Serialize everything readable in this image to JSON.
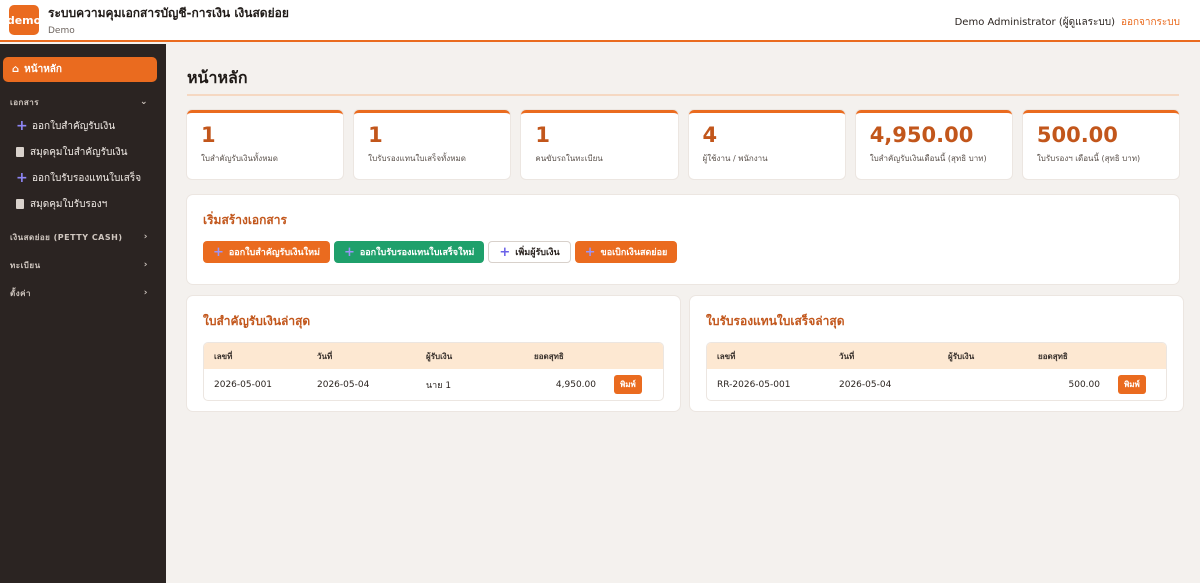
{
  "header": {
    "logo": "demo",
    "app_title": "ระบบความคุมเอกสารบัญชี-การเงิน เงินสดย่อย",
    "app_subtitle": "Demo",
    "user": "Demo Administrator (ผู้ดูแลระบบ)",
    "logout": "ออกจากระบบ"
  },
  "sidebar": {
    "home": "หน้าหลัก",
    "section_docs": "เอกสาร",
    "items": [
      {
        "label": "ออกใบสำคัญรับเงิน",
        "icon": "plus-icon"
      },
      {
        "label": "สมุดคุมใบสำคัญรับเงิน",
        "icon": "document-icon"
      },
      {
        "label": "ออกใบรับรองแทนใบเสร็จ",
        "icon": "plus-icon"
      },
      {
        "label": "สมุดคุมใบรับรองฯ",
        "icon": "document-icon"
      }
    ],
    "section_petty": "เงินสดย่อย (PETTY CASH)",
    "section_registry": "ทะเบียน",
    "section_settings": "ตั้งค่า"
  },
  "main": {
    "page_title": "หน้าหลัก",
    "stats": [
      {
        "value": "1",
        "label": "ใบสำคัญรับเงินทั้งหมด"
      },
      {
        "value": "1",
        "label": "ใบรับรองแทนใบเสร็จทั้งหมด"
      },
      {
        "value": "1",
        "label": "คนขับรถในทะเบียน"
      },
      {
        "value": "4",
        "label": "ผู้ใช้งาน / พนักงาน"
      },
      {
        "value": "4,950.00",
        "label": "ใบสำคัญรับเงินเดือนนี้ (สุทธิ บาท)"
      },
      {
        "value": "500.00",
        "label": "ใบรับรองฯ เดือนนี้ (สุทธิ บาท)"
      }
    ],
    "quick": {
      "title": "เริ่มสร้างเอกสาร",
      "buttons": [
        "ออกใบสำคัญรับเงินใหม่",
        "ออกใบรับรองแทนใบเสร็จใหม่",
        "เพิ่มผู้รับเงิน",
        "ขอเบิกเงินสดย่อย"
      ]
    },
    "receipts": {
      "title": "ใบสำคัญรับเงินล่าสุด",
      "headers": [
        "เลขที่",
        "วันที่",
        "ผู้รับเงิน",
        "ยอดสุทธิ"
      ],
      "rows": [
        {
          "no": "2026-05-001",
          "date": "2026-05-04",
          "payee": "นาย 1",
          "amount": "4,950.00",
          "action": "พิมพ์"
        }
      ]
    },
    "certs": {
      "title": "ใบรับรองแทนใบเสร็จล่าสุด",
      "headers": [
        "เลขที่",
        "วันที่",
        "ผู้รับเงิน",
        "ยอดสุทธิ"
      ],
      "rows": [
        {
          "no": "RR-2026-05-001",
          "date": "2026-05-04",
          "payee": "",
          "amount": "500.00",
          "action": "พิมพ์"
        }
      ]
    }
  },
  "colors": {
    "accent": "#ea6b1f",
    "green": "#1fa06b",
    "sidebar": "#2b2422"
  }
}
